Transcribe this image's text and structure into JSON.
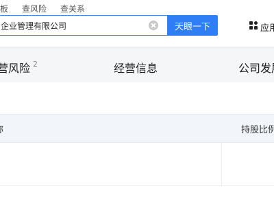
{
  "search_tabs": [
    "板",
    "查风险",
    "查关系"
  ],
  "search": {
    "value": "企业管理有限公司",
    "button_label": "天眼一下"
  },
  "apps_entry": {
    "label": "应用"
  },
  "company_tabs": [
    {
      "label": "营风险",
      "count": "2"
    },
    {
      "label": "经营信息"
    },
    {
      "label": "公司发展"
    }
  ],
  "table": {
    "columns": [
      "称",
      "持股比例"
    ]
  },
  "colors": {
    "accent": "#2f7ef5",
    "tab_bar_bg": "#f5f6f8",
    "table_header_bg": "#f2f6fb"
  },
  "icons": {
    "clear": "clear-icon",
    "apps": "apps-grid-icon"
  }
}
